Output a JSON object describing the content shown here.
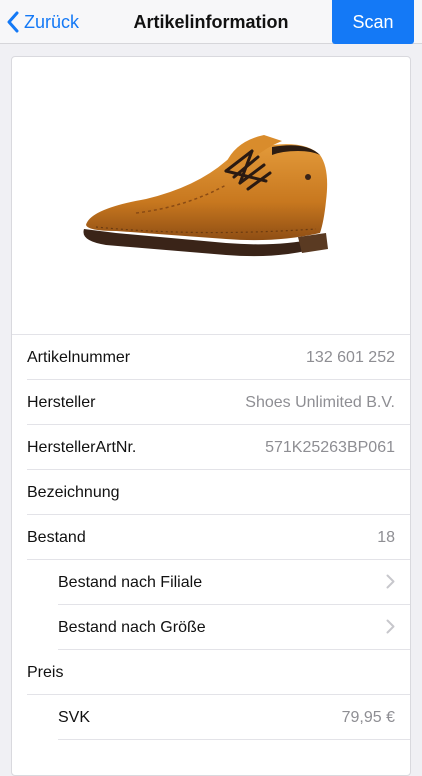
{
  "nav": {
    "back_label": "Zurück",
    "title": "Artikelinformation",
    "scan_label": "Scan"
  },
  "colors": {
    "accent": "#1479f6",
    "background": "#f0f0f4",
    "value_text": "#8e8e93"
  },
  "rows": [
    {
      "label": "Artikelnummer",
      "value": "132 601 252"
    },
    {
      "label": "Hersteller",
      "value": "Shoes Unlimited B.V."
    },
    {
      "label": "HerstellerArtNr.",
      "value": "571K25263BP061"
    },
    {
      "label": "Bezeichnung",
      "value": ""
    },
    {
      "label": "Bestand",
      "value": "18"
    },
    {
      "label": "Bestand nach Filiale",
      "value": ""
    },
    {
      "label": "Bestand nach Größe",
      "value": ""
    },
    {
      "label": "Preis",
      "value": ""
    },
    {
      "label": "SVK",
      "value": "79,95 €"
    }
  ]
}
